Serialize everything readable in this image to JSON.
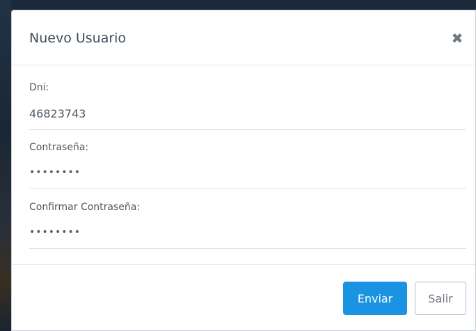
{
  "modal": {
    "title": "Nuevo Usuario",
    "close_icon": "close-icon"
  },
  "form": {
    "dni": {
      "label": "Dni:",
      "value": "46823743"
    },
    "password": {
      "label": "Contraseña:",
      "masked_value": "••••••••"
    },
    "confirm_password": {
      "label": "Confirmar Contraseña:",
      "masked_value": "••••••••"
    }
  },
  "footer": {
    "submit_label": "Enviar",
    "exit_label": "Salir"
  },
  "colors": {
    "primary": "#1a93e3",
    "text": "#4d5862"
  }
}
